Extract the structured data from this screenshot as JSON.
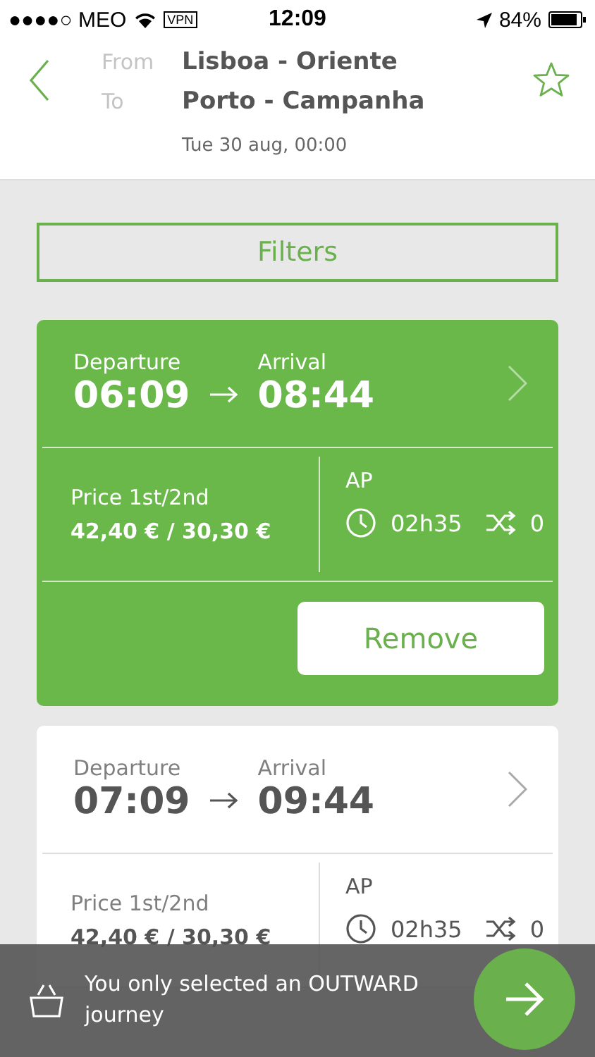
{
  "status_bar": {
    "carrier": "●●●●○ MEO",
    "vpn": "VPN",
    "time": "12:09",
    "battery": "84%"
  },
  "header": {
    "from_label": "From",
    "from": "Lisboa - Oriente",
    "to_label": "To",
    "to": "Porto - Campanha",
    "date": "Tue 30 aug, 00:00",
    "favorite": false
  },
  "filters_button": "Filters",
  "journeys": [
    {
      "selected": true,
      "departure_label": "Departure",
      "departure": "06:09",
      "arrival_label": "Arrival",
      "arrival": "08:44",
      "price_label": "Price 1st/2nd",
      "price": "42,40 € / 30,30 €",
      "service": "AP",
      "duration": "02h35",
      "changes": "0",
      "action": "Remove"
    },
    {
      "selected": false,
      "departure_label": "Departure",
      "departure": "07:09",
      "arrival_label": "Arrival",
      "arrival": "09:44",
      "price_label": "Price 1st/2nd",
      "price": "42,40 € / 30,30 €",
      "service": "AP",
      "duration": "02h35",
      "changes": "0"
    }
  ],
  "notice": {
    "message": "You only selected an OUTWARD journey"
  }
}
